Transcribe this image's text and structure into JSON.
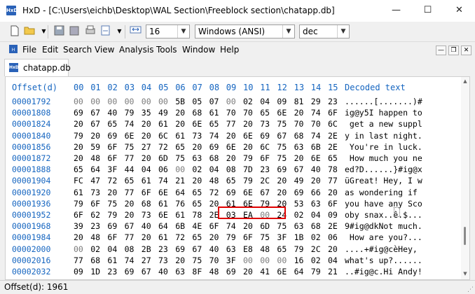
{
  "window": {
    "title": "HxD - [C:\\Users\\eichb\\Desktop\\WAL Section\\Freeblock section\\chatapp.db]",
    "minimize": "—",
    "maximize": "☐",
    "close": "✕"
  },
  "toolbar": {
    "bytes_per_row": "16",
    "charset": "Windows (ANSI)",
    "offset_base": "dec"
  },
  "menu": [
    "File",
    "Edit",
    "Search",
    "View",
    "Analysis",
    "Tools",
    "Window",
    "Help"
  ],
  "tab": {
    "label": "chatapp.db"
  },
  "hex": {
    "offset_header": "Offset(d)",
    "column_headers": [
      "00",
      "01",
      "02",
      "03",
      "04",
      "05",
      "06",
      "07",
      "08",
      "09",
      "10",
      "11",
      "12",
      "13",
      "14",
      "15"
    ],
    "decoded_header": "Decoded text",
    "rows": [
      {
        "offset": "00001792",
        "bytes": [
          "00",
          "00",
          "00",
          "00",
          "00",
          "00",
          "5B",
          "05",
          "07",
          "00",
          "02",
          "04",
          "09",
          "81",
          "29",
          "23"
        ],
        "text": "......[.......)#"
      },
      {
        "offset": "00001808",
        "bytes": [
          "69",
          "67",
          "40",
          "79",
          "35",
          "49",
          "20",
          "68",
          "61",
          "70",
          "70",
          "65",
          "6E",
          "20",
          "74",
          "6F"
        ],
        "text": "ig@y5I happen to"
      },
      {
        "offset": "00001824",
        "bytes": [
          "20",
          "67",
          "65",
          "74",
          "20",
          "61",
          "20",
          "6E",
          "65",
          "77",
          "20",
          "73",
          "75",
          "70",
          "70",
          "6C"
        ],
        "text": " get a new suppl"
      },
      {
        "offset": "00001840",
        "bytes": [
          "79",
          "20",
          "69",
          "6E",
          "20",
          "6C",
          "61",
          "73",
          "74",
          "20",
          "6E",
          "69",
          "67",
          "68",
          "74",
          "2E"
        ],
        "text": "y in last night."
      },
      {
        "offset": "00001856",
        "bytes": [
          "20",
          "59",
          "6F",
          "75",
          "27",
          "72",
          "65",
          "20",
          "69",
          "6E",
          "20",
          "6C",
          "75",
          "63",
          "6B",
          "2E"
        ],
        "text": " You're in luck."
      },
      {
        "offset": "00001872",
        "bytes": [
          "20",
          "48",
          "6F",
          "77",
          "20",
          "6D",
          "75",
          "63",
          "68",
          "20",
          "79",
          "6F",
          "75",
          "20",
          "6E",
          "65"
        ],
        "text": " How much you ne"
      },
      {
        "offset": "00001888",
        "bytes": [
          "65",
          "64",
          "3F",
          "44",
          "04",
          "06",
          "00",
          "02",
          "04",
          "08",
          "7D",
          "23",
          "69",
          "67",
          "40",
          "78"
        ],
        "text": "ed?D......}#ig@x"
      },
      {
        "offset": "00001904",
        "bytes": [
          "FC",
          "47",
          "72",
          "65",
          "61",
          "74",
          "21",
          "20",
          "48",
          "65",
          "79",
          "2C",
          "20",
          "49",
          "20",
          "77"
        ],
        "text": "üGreat! Hey, I w"
      },
      {
        "offset": "00001920",
        "bytes": [
          "61",
          "73",
          "20",
          "77",
          "6F",
          "6E",
          "64",
          "65",
          "72",
          "69",
          "6E",
          "67",
          "20",
          "69",
          "66",
          "20"
        ],
        "text": "as wondering if "
      },
      {
        "offset": "00001936",
        "bytes": [
          "79",
          "6F",
          "75",
          "20",
          "68",
          "61",
          "76",
          "65",
          "20",
          "61",
          "6E",
          "79",
          "20",
          "53",
          "63",
          "6F"
        ],
        "text": "you have any Sco"
      },
      {
        "offset": "00001952",
        "bytes": [
          "6F",
          "62",
          "79",
          "20",
          "73",
          "6E",
          "61",
          "78",
          "2E",
          "03",
          "EA",
          "00",
          "24",
          "02",
          "04",
          "09"
        ],
        "text": "oby snax..ê.$..."
      },
      {
        "offset": "00001968",
        "bytes": [
          "39",
          "23",
          "69",
          "67",
          "40",
          "64",
          "6B",
          "4E",
          "6F",
          "74",
          "20",
          "6D",
          "75",
          "63",
          "68",
          "2E"
        ],
        "text": "9#ig@dkNot much."
      },
      {
        "offset": "00001984",
        "bytes": [
          "20",
          "48",
          "6F",
          "77",
          "20",
          "61",
          "72",
          "65",
          "20",
          "79",
          "6F",
          "75",
          "3F",
          "1B",
          "02",
          "06"
        ],
        "text": " How are you?..."
      },
      {
        "offset": "00002000",
        "bytes": [
          "00",
          "02",
          "04",
          "08",
          "2B",
          "23",
          "69",
          "67",
          "40",
          "63",
          "E8",
          "48",
          "65",
          "79",
          "2C",
          "20"
        ],
        "text": "....+#ig@cèHey, "
      },
      {
        "offset": "00002016",
        "bytes": [
          "77",
          "68",
          "61",
          "74",
          "27",
          "73",
          "20",
          "75",
          "70",
          "3F",
          "00",
          "00",
          "00",
          "16",
          "02",
          "04"
        ],
        "text": "what's up?......"
      },
      {
        "offset": "00002032",
        "bytes": [
          "09",
          "1D",
          "23",
          "69",
          "67",
          "40",
          "63",
          "8F",
          "48",
          "69",
          "20",
          "41",
          "6E",
          "64",
          "79",
          "21"
        ],
        "text": "..#ig@c.Hi Andy!"
      }
    ]
  },
  "status": {
    "text": "Offset(d): 1961"
  }
}
